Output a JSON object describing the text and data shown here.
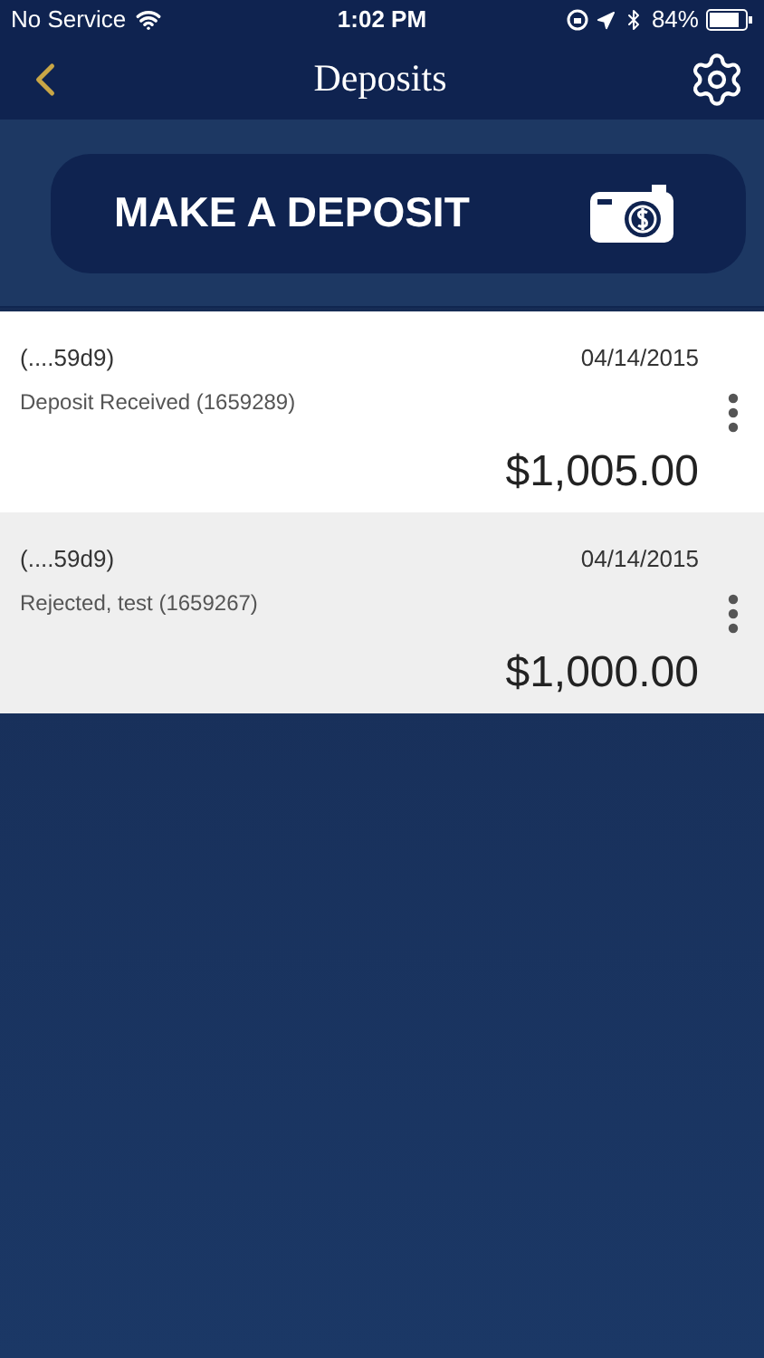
{
  "status_bar": {
    "carrier": "No Service",
    "time": "1:02 PM",
    "battery": "84%"
  },
  "nav": {
    "title": "Deposits"
  },
  "deposit_button": {
    "label": "MAKE A DEPOSIT"
  },
  "deposits": [
    {
      "account": "(....59d9)",
      "date": "04/14/2015",
      "description": "Deposit Received (1659289)",
      "amount": "$1,005.00"
    },
    {
      "account": "(....59d9)",
      "date": "04/14/2015",
      "description": "Rejected, test (1659267)",
      "amount": "$1,000.00"
    }
  ]
}
